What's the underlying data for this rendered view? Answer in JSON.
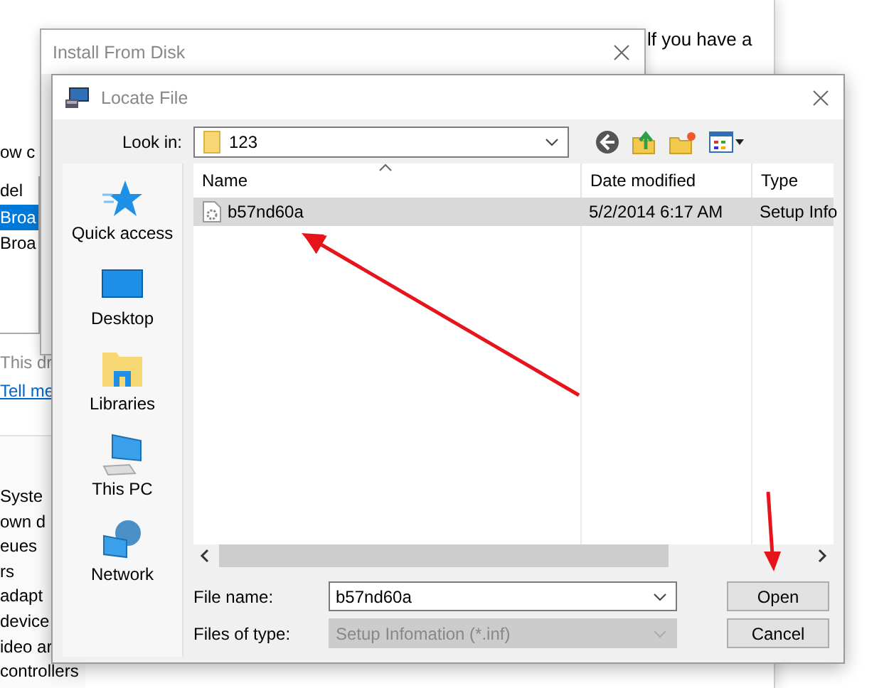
{
  "background_window": {
    "right_fragment": "lf you have a",
    "section_label": "ow c",
    "model_header": "del",
    "model_rows": [
      {
        "text": "Broa",
        "selected": true
      },
      {
        "text": "Broa",
        "selected": false
      }
    ],
    "note": "This dr",
    "link": "Tell me",
    "device_list": [
      "Syste",
      "own d",
      "eues",
      "rs",
      "adapt",
      "device",
      "ideo ar",
      "controllers"
    ]
  },
  "install_dialog": {
    "title": "Install From Disk"
  },
  "locate_dialog": {
    "title": "Locate File",
    "look_in": {
      "label": "Look in:",
      "value": "123"
    },
    "places": [
      {
        "label": "Quick access",
        "kind": "star"
      },
      {
        "label": "Desktop",
        "kind": "desktop"
      },
      {
        "label": "Libraries",
        "kind": "libraries"
      },
      {
        "label": "This PC",
        "kind": "pc"
      },
      {
        "label": "Network",
        "kind": "network"
      }
    ],
    "columns": [
      "Name",
      "Date modified",
      "Type"
    ],
    "files": [
      {
        "name": "b57nd60a",
        "date": "5/2/2014 6:17 AM",
        "type": "Setup Info",
        "selected": true
      }
    ],
    "file_name": {
      "label": "File name:",
      "value": "b57nd60a"
    },
    "file_type": {
      "label": "Files of type:",
      "value": "Setup Infomation (*.inf)",
      "disabled": true
    },
    "buttons": [
      "Open",
      "Cancel"
    ]
  }
}
